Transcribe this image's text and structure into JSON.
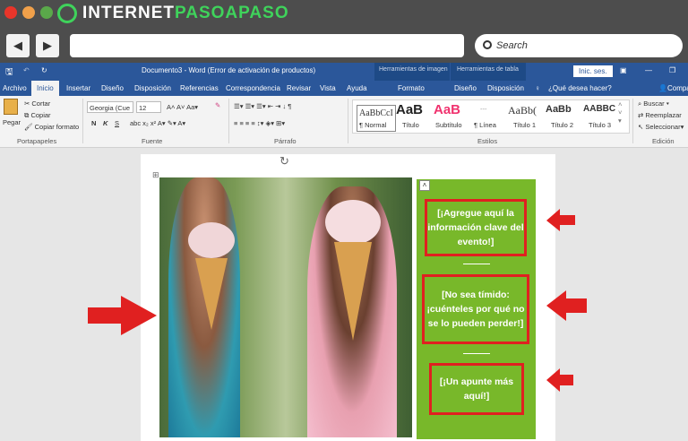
{
  "browser": {
    "logo_text_a": "INTERNET",
    "logo_text_b": "PASOAPASO",
    "search_placeholder": "Search"
  },
  "word": {
    "title": "Documento3  -  Word (Error de activación de productos)",
    "context_image": "Herramientas de imagen",
    "context_table": "Herramientas de tabla",
    "signin": "Inic. ses.",
    "tabs": [
      "Archivo",
      "Inicio",
      "Insertar",
      "Diseño",
      "Disposición",
      "Referencias",
      "Correspondencia",
      "Revisar",
      "Vista",
      "Ayuda",
      "Formato",
      "Diseño",
      "Disposición"
    ],
    "tell_me": "¿Qué desea hacer?",
    "share": "Compartir",
    "clipboard": {
      "paste": "Pegar",
      "cut": "Cortar",
      "copy": "Copiar",
      "format_painter": "Copiar formato",
      "group": "Portapapeles"
    },
    "font": {
      "name": "Georgia (Cue",
      "size": "12",
      "group": "Fuente",
      "bold": "N",
      "italic": "K",
      "underline": "S"
    },
    "paragraph": {
      "group": "Párrafo"
    },
    "styles": {
      "group": "Estilos",
      "items": [
        {
          "preview": "AaBbCcI",
          "label": "¶ Normal"
        },
        {
          "preview": "AaB",
          "label": "Título"
        },
        {
          "preview": "AaB",
          "label": "Subtítulo"
        },
        {
          "preview": "---",
          "label": "¶ Línea"
        },
        {
          "preview": "AaBb(",
          "label": "Título 1"
        },
        {
          "preview": "AaBb",
          "label": "Título 2"
        },
        {
          "preview": "AABBC",
          "label": "Título 3"
        }
      ]
    },
    "editing": {
      "find": "Buscar",
      "replace": "Reemplazar",
      "select": "Seleccionar",
      "group": "Edición"
    }
  },
  "document": {
    "boxes": [
      "¡Agregue aquí la información clave del evento!",
      "[No sea tímido: ¡cuénteles por qué no se lo pueden perder!]",
      "[¡Un apunte más aquí!]"
    ],
    "box1": "[¡Agregue aquí la información clave del evento!]"
  },
  "colors": {
    "word_blue": "#2b579a",
    "sidebar_green": "#78b82a",
    "arrow_red": "#e02020"
  }
}
